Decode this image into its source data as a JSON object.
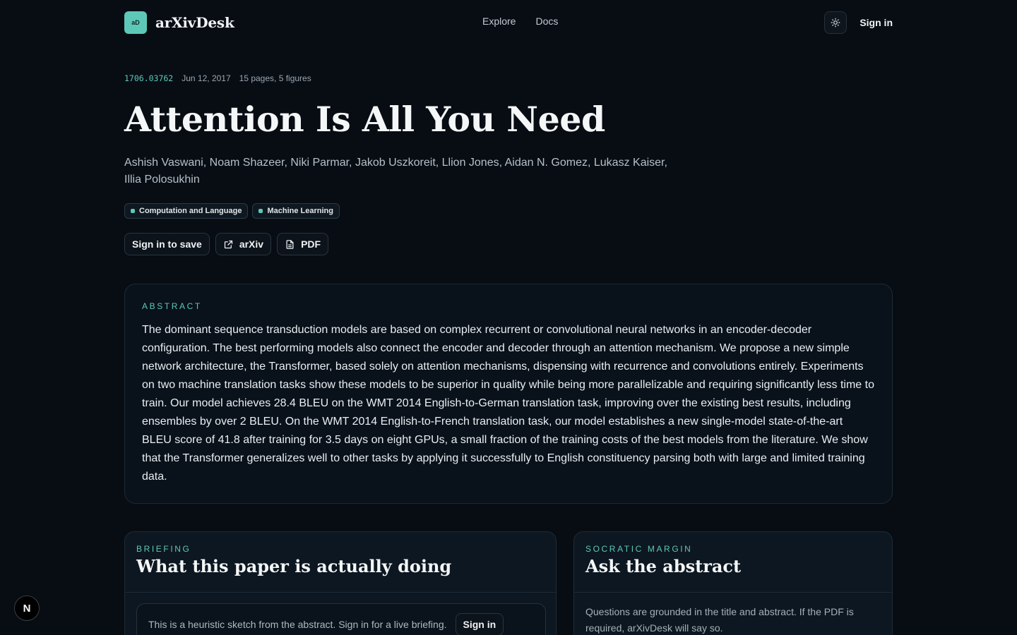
{
  "header": {
    "logo_text": "aD",
    "brand": "arXivDesk",
    "nav": [
      "Explore",
      "Docs"
    ],
    "theme_icon": "sun-icon",
    "sign_in": "Sign in"
  },
  "paper": {
    "id": "1706.03762",
    "date": "Jun 12, 2017",
    "pages": "15 pages, 5 figures",
    "title": "Attention Is All You Need",
    "authors": "Ashish Vaswani, Noam Shazeer, Niki Parmar, Jakob Uszkoreit, Llion Jones, Aidan N. Gomez, Lukasz Kaiser, Illia Polosukhin",
    "tags": [
      "Computation and Language",
      "Machine Learning"
    ],
    "actions": {
      "save": "Sign in to save",
      "arxiv": "arXiv",
      "pdf": "PDF"
    }
  },
  "abstract": {
    "label": "ABSTRACT",
    "text": "The dominant sequence transduction models are based on complex recurrent or convolutional neural networks in an encoder-decoder configuration. The best performing models also connect the encoder and decoder through an attention mechanism. We propose a new simple network architecture, the Transformer, based solely on attention mechanisms, dispensing with recurrence and convolutions entirely. Experiments on two machine translation tasks show these models to be superior in quality while being more parallelizable and requiring significantly less time to train. Our model achieves 28.4 BLEU on the WMT 2014 English-to-German translation task, improving over the existing best results, including ensembles by over 2 BLEU. On the WMT 2014 English-to-French translation task, our model establishes a new single-model state-of-the-art BLEU score of 41.8 after training for 3.5 days on eight GPUs, a small fraction of the training costs of the best models from the literature. We show that the Transformer generalizes well to other tasks by applying it successfully to English constituency parsing both with large and limited training data."
  },
  "briefing": {
    "label": "BRIEFING",
    "title": "What this paper is actually doing",
    "notice": "This is a heuristic sketch from the abstract. Sign in for a live briefing.",
    "button": "Sign in"
  },
  "socratic": {
    "label": "SOCRATIC MARGIN",
    "title": "Ask the abstract",
    "text": "Questions are grounded in the title and abstract. If the PDF is required, arXivDesk will say so."
  },
  "dev_badge": "N",
  "colors": {
    "accent": "#5ec8b8",
    "background": "#080d14"
  }
}
